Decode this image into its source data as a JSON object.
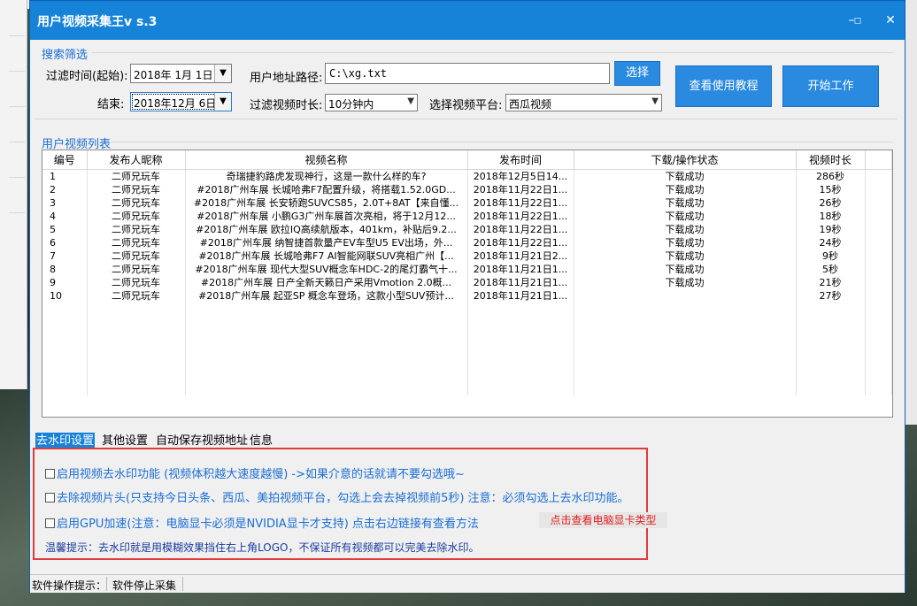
{
  "window": {
    "title": "用户视频采集王v s.3",
    "controls": {
      "minimize": "–",
      "maximize": "▫",
      "close": "✕"
    }
  },
  "filter": {
    "group_title": "搜索筛选",
    "start_label": "过滤时间(起始):",
    "start_value": "2018年 1月 1日",
    "end_label": "结束:",
    "end_value": "2018年12月 6日",
    "path_label": "用户地址路径:",
    "path_value": "C:\\xg.txt",
    "select_button": "选择",
    "duration_label": "过滤视频时长:",
    "duration_value": "10分钟内",
    "platform_label": "选择视频平台:",
    "platform_value": "西瓜视频",
    "tutorial_button": "查看使用教程",
    "start_button": "开始工作"
  },
  "list": {
    "group_title": "用户视频列表",
    "columns": [
      "编号",
      "发布人昵称",
      "视频名称",
      "发布时间",
      "下载/操作状态",
      "视频时长"
    ],
    "rows": [
      [
        "1",
        "二师兄玩车",
        "奇瑞捷豹路虎发现神行，这是一款什么样的车?",
        "2018年12月5日14...",
        "下载成功",
        "286秒"
      ],
      [
        "2",
        "二师兄玩车",
        "#2018广州车展 长城哈弗F7配置升级，将搭载1.52.0GD...",
        "2018年11月22日1...",
        "下载成功",
        "15秒"
      ],
      [
        "3",
        "二师兄玩车",
        "#2018广州车展 长安轿跑SUVCS85，2.0T+8AT【来自懂...",
        "2018年11月22日1...",
        "下载成功",
        "26秒"
      ],
      [
        "4",
        "二师兄玩车",
        "#2018广州车展 小鹏G3广州车展首次亮相，将于12月12...",
        "2018年11月22日1...",
        "下载成功",
        "18秒"
      ],
      [
        "5",
        "二师兄玩车",
        "#2018广州车展 欧拉IQ高续航版本，401km，补贴后9.2...",
        "2018年11月22日1...",
        "下载成功",
        "19秒"
      ],
      [
        "6",
        "二师兄玩车",
        "#2018广州车展 纳智捷首款量产EV车型U5 EV出场，外...",
        "2018年11月22日1...",
        "下载成功",
        "24秒"
      ],
      [
        "7",
        "二师兄玩车",
        "#2018广州车展 长城哈弗F7 AI智能网联SUV亮相广州【...",
        "2018年11月21日2...",
        "下载成功",
        "9秒"
      ],
      [
        "8",
        "二师兄玩车",
        "#2018广州车展 现代大型SUV概念车HDC-2的尾灯霸气十...",
        "2018年11月21日1...",
        "下载成功",
        "5秒"
      ],
      [
        "9",
        "二师兄玩车",
        "#2018广州车展 日产全新天籁日产采用Vmotion 2.0概...",
        "2018年11月21日1...",
        "下载成功",
        "21秒"
      ],
      [
        "10",
        "二师兄玩车",
        "#2018广州车展 起亚SP 概念车登场，这款小型SUV预计...",
        "2018年11月21日1...",
        "",
        "27秒"
      ]
    ]
  },
  "tabs": [
    "去水印设置",
    "其他设置",
    "自动保存视频地址",
    "信息"
  ],
  "watermark": {
    "opt1": "启用视频去水印功能 (视频体积越大速度越慢) ->如果介意的话就请不要勾选哦~",
    "opt2": "去除视频片头(只支持今日头条、西瓜、美拍视频平台，勾选上会去掉视频前5秒) 注意：必须勾选上去水印功能。",
    "opt3": "启用GPU加速(注意：电脑显卡必须是NVIDIA显卡才支持) 点击右边链接有查看方法",
    "gpu_link": "点击查看电脑显卡类型",
    "tip": "温馨提示：去水印就是用模糊效果挡住右上角LOGO，不保证所有视频都可以完美去除水印。"
  },
  "status": {
    "label": "软件操作提示：",
    "value": "软件停止采集"
  },
  "colors": {
    "accent": "#1683d8",
    "group_title": "#1b6ed3",
    "highlight_border": "#e23b3b",
    "link_red": "#e02020"
  }
}
